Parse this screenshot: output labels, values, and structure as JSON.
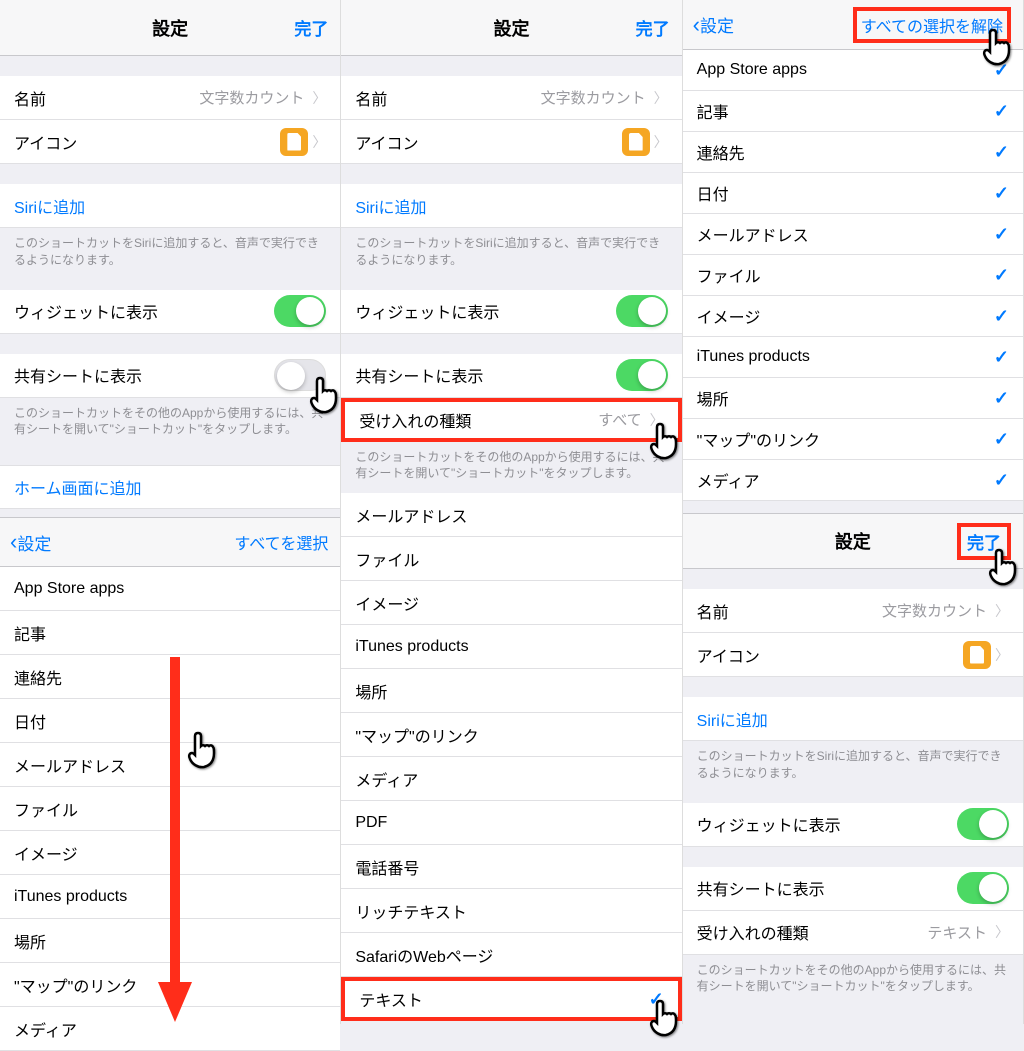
{
  "nav": {
    "settings": "設定",
    "done": "完了",
    "back_settings": "設定",
    "select_all": "すべてを選択",
    "deselect_all": "すべての選択を解除"
  },
  "rows": {
    "name_label": "名前",
    "name_value": "文字数カウント",
    "icon_label": "アイコン",
    "siri_add": "Siriに追加",
    "siri_footer": "このショートカットをSiriに追加すると、音声で実行できるようになります。",
    "widget_show": "ウィジェットに表示",
    "share_sheet_show": "共有シートに表示",
    "share_footer": "このショートカットをその他のAppから使用するには、共有シートを開いて\"ショートカット\"をタップします。",
    "home_add": "ホーム画面に追加",
    "accept_types": "受け入れの種類",
    "accept_all": "すべて",
    "accept_text": "テキスト"
  },
  "types": {
    "appstore": "App Store apps",
    "article": "記事",
    "contact": "連絡先",
    "date": "日付",
    "email": "メールアドレス",
    "file": "ファイル",
    "image": "イメージ",
    "itunes": "iTunes products",
    "location": "場所",
    "maplink": "\"マップ\"のリンク",
    "media": "メディア",
    "pdf": "PDF",
    "phone": "電話番号",
    "richtext": "リッチテキスト",
    "safari": "SafariのWebページ",
    "text": "テキスト"
  }
}
